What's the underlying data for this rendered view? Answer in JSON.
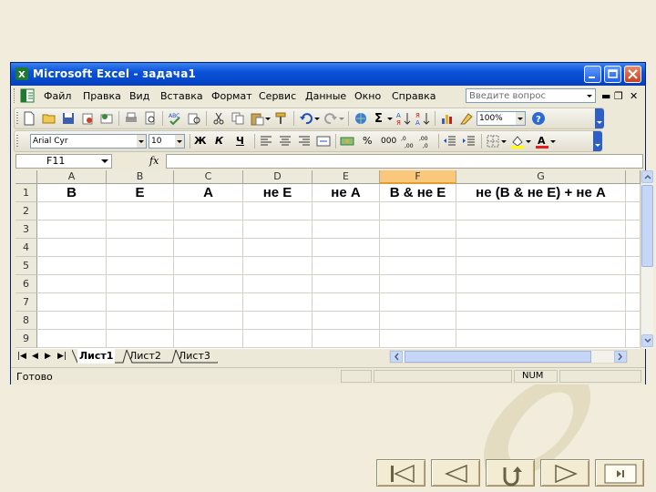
{
  "window": {
    "title": "Microsoft Excel - задача1"
  },
  "menu": {
    "items": [
      "Файл",
      "Правка",
      "Вид",
      "Вставка",
      "Формат",
      "Сервис",
      "Данные",
      "Окно",
      "Справка"
    ],
    "ask_placeholder": "Введите вопрос"
  },
  "format_toolbar": {
    "font": "Arial Cyr",
    "size": "10",
    "zoom": "100%"
  },
  "formula_bar": {
    "cell_ref": "F11",
    "fx": "fx",
    "value": ""
  },
  "grid": {
    "columns": [
      "A",
      "B",
      "C",
      "D",
      "E",
      "F",
      "G"
    ],
    "selected_column": "F",
    "rows": [
      "1",
      "2",
      "3",
      "4",
      "5",
      "6",
      "7",
      "8",
      "9"
    ],
    "row1": [
      "В",
      "Е",
      "А",
      "не Е",
      "не А",
      "В & не Е",
      "не (В & не Е) + не А"
    ]
  },
  "sheets": {
    "tabs": [
      "Лист1",
      "Лист2",
      "Лист3"
    ],
    "active": "Лист1"
  },
  "status": {
    "text": "Готово",
    "num": "NUM"
  },
  "colors": {
    "title_bar": "#0a52d8",
    "selected_header": "#f9c87b",
    "background": "#f1ecdc"
  }
}
